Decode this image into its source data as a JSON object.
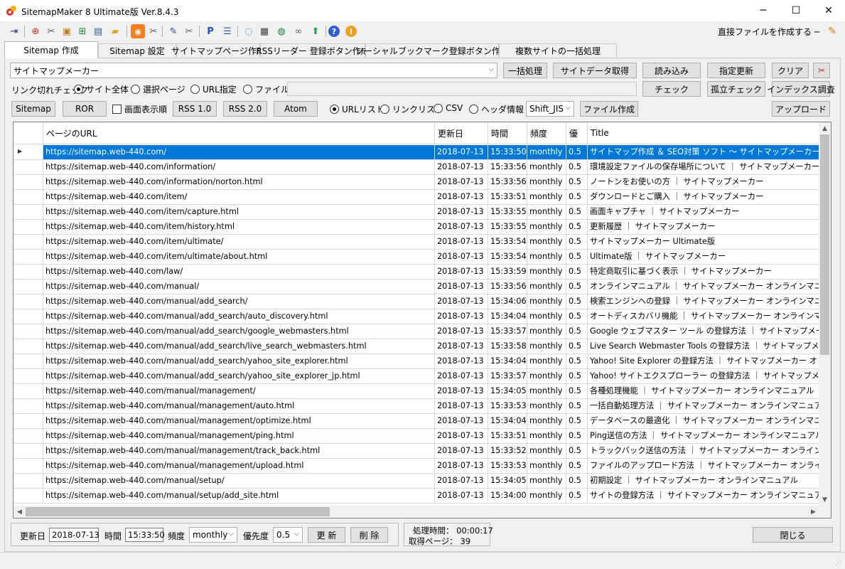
{
  "window": {
    "title": "SitemapMaker 8 Ultimate版  Ver.8.4.3",
    "controls": {
      "minimize": "─",
      "maximize": "☐",
      "close": "✕"
    }
  },
  "toolbar": {
    "direct_label": "直接ファイルを作成する ─",
    "icons": [
      "exit-icon",
      "globe-icon",
      "tools-icon",
      "package-icon",
      "network-icon",
      "monitor-icon",
      "folder-icon",
      "rss-icon",
      "tools2-icon",
      "edit-icon",
      "settings-icon",
      "pin-icon",
      "list-icon",
      "chat-icon",
      "printer-icon",
      "web-icon",
      "link-icon",
      "export-icon",
      "help-icon",
      "info-icon"
    ]
  },
  "tabs": [
    {
      "label": "Sitemap 作成",
      "active": true
    },
    {
      "label": "Sitemap 設定"
    },
    {
      "label": "サイトマップページ作成"
    },
    {
      "label": "RSSリーダー 登録ボタン作成"
    },
    {
      "label": "ソーシャルブックマーク登録ボタン作成"
    },
    {
      "label": "複数サイトの一括処理"
    }
  ],
  "controls": {
    "site_select": "サイトマップメーカー",
    "batch_btn": "一括処理",
    "fetch_btn": "サイトデータ取得",
    "load_btn": "読み込み",
    "update_btn": "指定更新",
    "clear_btn": "クリア",
    "link_check_label": "リンク切れチェック",
    "link_opts": [
      {
        "label": "サイト全体",
        "on": true
      },
      {
        "label": "選択ページ",
        "on": false
      },
      {
        "label": "URL指定",
        "on": false
      },
      {
        "label": "ファイル",
        "on": false
      }
    ],
    "check_btn": "チェック",
    "isolated_btn": "孤立チェック",
    "index_btn": "インデックス調査",
    "sitemap_btn": "Sitemap",
    "ror_btn": "ROR",
    "display_order_label": "画面表示順",
    "rss10_btn": "RSS 1.0",
    "rss20_btn": "RSS 2.0",
    "atom_btn": "Atom",
    "list_opts": [
      {
        "label": "URLリスト",
        "on": true
      },
      {
        "label": "リンクリスト",
        "on": false
      },
      {
        "label": "CSV",
        "on": false
      },
      {
        "label": "ヘッダ情報",
        "on": false
      }
    ],
    "encoding": "Shift_JIS",
    "makefile_btn": "ファイル作成",
    "upload_btn": "アップロード"
  },
  "grid": {
    "headers": [
      "ページのURL",
      "更新日",
      "時間",
      "頻度",
      "優",
      "Title"
    ],
    "rows": [
      [
        "https://sitemap.web-440.com/",
        "2018-07-13",
        "15:33:50",
        "monthly",
        "0.5",
        "サイトマップ作成 ＆ SEO対策 ソフト 〜 サイトマップメーカー 〜"
      ],
      [
        "https://sitemap.web-440.com/information/",
        "2018-07-13",
        "15:33:56",
        "monthly",
        "0.5",
        "環境設定ファイルの保存場所について ｜ サイトマップメーカー"
      ],
      [
        "https://sitemap.web-440.com/information/norton.html",
        "2018-07-13",
        "15:33:56",
        "monthly",
        "0.5",
        "ノートンをお使いの方 ｜ サイトマップメーカー"
      ],
      [
        "https://sitemap.web-440.com/item/",
        "2018-07-13",
        "15:33:51",
        "monthly",
        "0.5",
        "ダウンロードとご購入 ｜ サイトマップメーカー"
      ],
      [
        "https://sitemap.web-440.com/item/capture.html",
        "2018-07-13",
        "15:33:55",
        "monthly",
        "0.5",
        "画面キャプチャ ｜ サイトマップメーカー"
      ],
      [
        "https://sitemap.web-440.com/item/history.html",
        "2018-07-13",
        "15:33:55",
        "monthly",
        "0.5",
        "更新履歴 ｜ サイトマップメーカー"
      ],
      [
        "https://sitemap.web-440.com/item/ultimate/",
        "2018-07-13",
        "15:33:54",
        "monthly",
        "0.5",
        "サイトマップメーカー Ultimate版"
      ],
      [
        "https://sitemap.web-440.com/item/ultimate/about.html",
        "2018-07-13",
        "15:33:54",
        "monthly",
        "0.5",
        "Ultimate版 ｜ サイトマップメーカー"
      ],
      [
        "https://sitemap.web-440.com/law/",
        "2018-07-13",
        "15:33:59",
        "monthly",
        "0.5",
        "特定商取引に基づく表示 ｜ サイトマップメーカー"
      ],
      [
        "https://sitemap.web-440.com/manual/",
        "2018-07-13",
        "15:33:56",
        "monthly",
        "0.5",
        "オンラインマニュアル ｜ サイトマップメーカー オンラインマニュアル"
      ],
      [
        "https://sitemap.web-440.com/manual/add_search/",
        "2018-07-13",
        "15:34:06",
        "monthly",
        "0.5",
        "検索エンジンへの登録 ｜ サイトマップメーカー オンラインマニュアル"
      ],
      [
        "https://sitemap.web-440.com/manual/add_search/auto_discovery.html",
        "2018-07-13",
        "15:34:04",
        "monthly",
        "0.5",
        "オートディスカバリ機能 ｜ サイトマップメーカー オンラインマニュアル"
      ],
      [
        "https://sitemap.web-440.com/manual/add_search/google_webmasters.html",
        "2018-07-13",
        "15:33:57",
        "monthly",
        "0.5",
        "Google ウェブマスター ツール の登録方法 ｜ サイトマップメーカー オン"
      ],
      [
        "https://sitemap.web-440.com/manual/add_search/live_search_webmasters.html",
        "2018-07-13",
        "15:33:58",
        "monthly",
        "0.5",
        "Live Search Webmaster Tools の登録方法 ｜ サイトマップメーカー"
      ],
      [
        "https://sitemap.web-440.com/manual/add_search/yahoo_site_explorer.html",
        "2018-07-13",
        "15:34:04",
        "monthly",
        "0.5",
        "Yahoo! Site Explorer の登録方法 ｜ サイトマップメーカー オンライン"
      ],
      [
        "https://sitemap.web-440.com/manual/add_search/yahoo_site_explorer_jp.html",
        "2018-07-13",
        "15:33:57",
        "monthly",
        "0.5",
        "Yahoo! サイトエクスプローラー の登録方法 ｜ サイトマップメーカー オン"
      ],
      [
        "https://sitemap.web-440.com/manual/management/",
        "2018-07-13",
        "15:34:05",
        "monthly",
        "0.5",
        "各種処理機能 ｜ サイトマップメーカー オンラインマニュアル"
      ],
      [
        "https://sitemap.web-440.com/manual/management/auto.html",
        "2018-07-13",
        "15:33:53",
        "monthly",
        "0.5",
        "一括自動処理方法 ｜ サイトマップメーカー オンラインマニュアル"
      ],
      [
        "https://sitemap.web-440.com/manual/management/optimize.html",
        "2018-07-13",
        "15:34:04",
        "monthly",
        "0.5",
        "データベースの最適化 ｜ サイトマップメーカー オンラインマニュアル"
      ],
      [
        "https://sitemap.web-440.com/manual/management/ping.html",
        "2018-07-13",
        "15:33:51",
        "monthly",
        "0.5",
        "Ping送信の方法 ｜ サイトマップメーカー オンラインマニュアル"
      ],
      [
        "https://sitemap.web-440.com/manual/management/track_back.html",
        "2018-07-13",
        "15:33:52",
        "monthly",
        "0.5",
        "トラックバック送信の方法 ｜ サイトマップメーカー オンラインマニュアル"
      ],
      [
        "https://sitemap.web-440.com/manual/management/upload.html",
        "2018-07-13",
        "15:33:53",
        "monthly",
        "0.5",
        "ファイルのアップロード方法 ｜ サイトマップメーカー オンラインマニュアル"
      ],
      [
        "https://sitemap.web-440.com/manual/setup/",
        "2018-07-13",
        "15:34:05",
        "monthly",
        "0.5",
        "初期設定 ｜ サイトマップメーカー オンラインマニュアル"
      ],
      [
        "https://sitemap.web-440.com/manual/setup/add_site.html",
        "2018-07-13",
        "15:34:00",
        "monthly",
        "0.5",
        "サイトの登録方法 ｜ サイトマップメーカー オンラインマニュアル"
      ]
    ]
  },
  "editor": {
    "date_label": "更新日",
    "date_value": "2018-07-13",
    "time_label": "時間",
    "time_value": "15:33:50",
    "freq_label": "頻度",
    "freq_value": "monthly",
    "priority_label": "優先度",
    "priority_value": "0.5",
    "update_btn": "更 新",
    "delete_btn": "削 除"
  },
  "status": {
    "time_label": "処理時間：",
    "time_value": "00:00:17",
    "pages_label": "取得ページ：",
    "pages_value": "39"
  },
  "close_btn": "閉じる"
}
